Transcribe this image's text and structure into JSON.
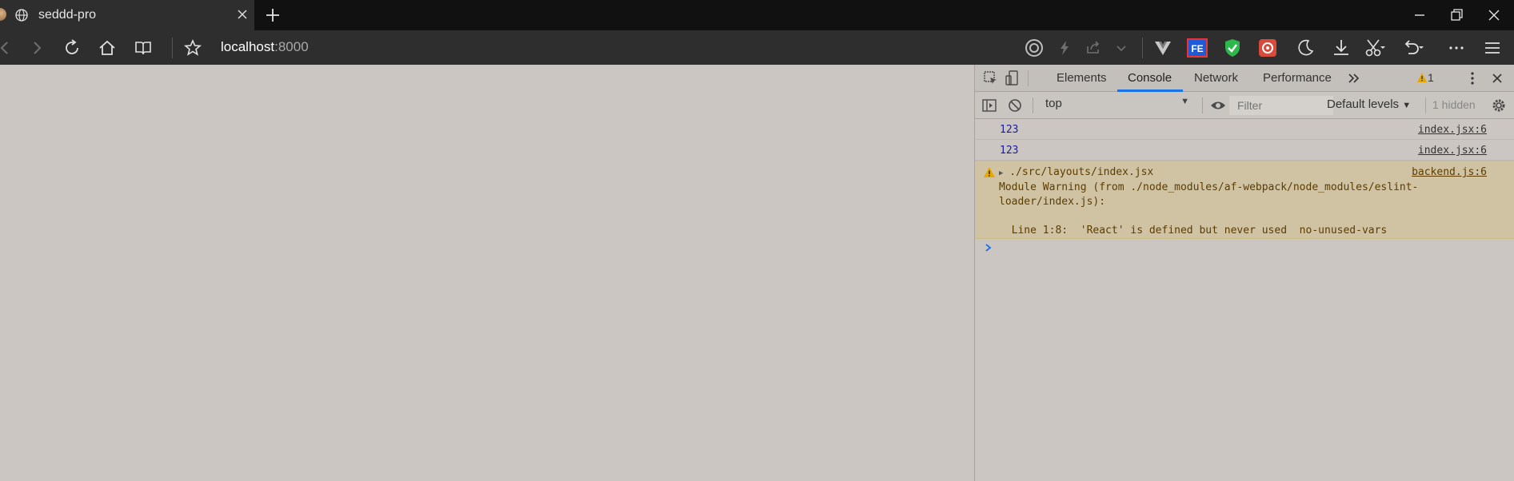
{
  "browser": {
    "tab": {
      "title": "seddd-pro",
      "favicon": "globe-icon"
    },
    "url": {
      "host": "localhost",
      "port": ":8000"
    },
    "window_controls": [
      "minimize",
      "restore",
      "close"
    ]
  },
  "devtools": {
    "tabs": [
      "Elements",
      "Console",
      "Network",
      "Performance"
    ],
    "active_tab": "Console",
    "warning_count": "1",
    "toolbar": {
      "context": "top",
      "filter_placeholder": "Filter",
      "levels": "Default levels",
      "hidden": "1 hidden"
    },
    "console": {
      "logs": [
        {
          "value": "123",
          "source": "index.jsx:6"
        },
        {
          "value": "123",
          "source": "index.jsx:6"
        }
      ],
      "warning": {
        "path": "./src/layouts/index.jsx",
        "source": "backend.js:6",
        "message": "Module Warning (from ./node_modules/af-webpack/node_modules/eslint-\nloader/index.js):\n\n  Line 1:8:  'React' is defined but never used  no-unused-vars"
      }
    }
  },
  "colors": {
    "accent": "#1a73e8",
    "page_bg": "#cbc6c1",
    "warning_bg": "#cfc3a4"
  }
}
